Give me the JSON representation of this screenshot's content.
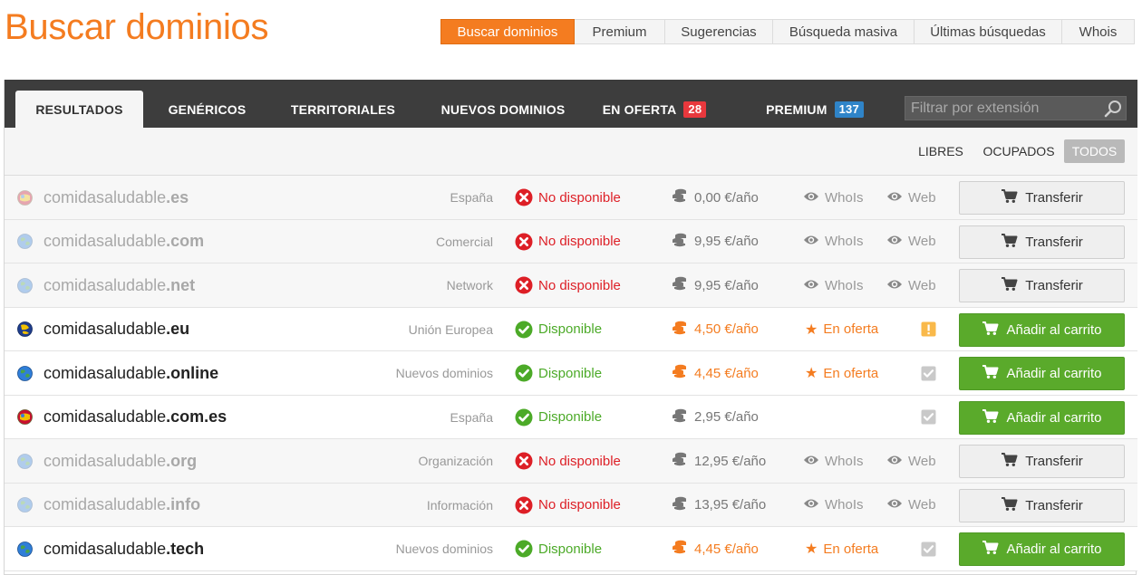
{
  "page": {
    "title": "Buscar dominios"
  },
  "topnav": [
    {
      "label": "Buscar dominios",
      "active": true,
      "w": 148
    },
    {
      "label": "Premium",
      "active": false,
      "w": 100
    },
    {
      "label": "Sugerencias",
      "active": false,
      "w": 119
    },
    {
      "label": "Búsqueda masiva",
      "active": false,
      "w": 156
    },
    {
      "label": "Últimas búsquedas",
      "active": false,
      "w": 163
    },
    {
      "label": "Whois",
      "active": false,
      "w": 80
    }
  ],
  "tabs": [
    {
      "label": "RESULTADOS",
      "active": true
    },
    {
      "label": "GENÉRICOS",
      "active": false
    },
    {
      "label": "TERRITORIALES",
      "active": false
    },
    {
      "label": "NUEVOS DOMINIOS",
      "active": false
    },
    {
      "label": "EN OFERTA",
      "badge": "28",
      "badge_color": "red",
      "active": false
    },
    {
      "label": "PREMIUM",
      "badge": "137",
      "badge_color": "blue",
      "active": false
    }
  ],
  "filter": {
    "placeholder": "Filtrar por extensión"
  },
  "subfilters": [
    {
      "label": "LIBRES",
      "active": false
    },
    {
      "label": "OCUPADOS",
      "active": false
    },
    {
      "label": "TODOS",
      "active": true
    }
  ],
  "labels": {
    "whois": "WhoIs",
    "web": "Web",
    "offer": "En oferta",
    "transfer": "Transferir",
    "add_cart": "Añadir al carrito",
    "available": "Disponible",
    "unavailable": "No disponible"
  },
  "colors": {
    "accent": "#f47c20",
    "available": "#4caa28",
    "unavailable": "#dd1f26",
    "cart": "#5aaa2b"
  },
  "domains": [
    {
      "name": "comidasaludable",
      "ext": ".es",
      "category": "España",
      "available": false,
      "price": "0,00 €/año",
      "offer": false,
      "icon": "globe-spain-icon"
    },
    {
      "name": "comidasaludable",
      "ext": ".com",
      "category": "Comercial",
      "available": false,
      "price": "9,95 €/año",
      "offer": false,
      "icon": "globe-icon"
    },
    {
      "name": "comidasaludable",
      "ext": ".net",
      "category": "Network",
      "available": false,
      "price": "9,95 €/año",
      "offer": false,
      "icon": "globe-icon"
    },
    {
      "name": "comidasaludable",
      "ext": ".eu",
      "category": "Unión Europea",
      "available": true,
      "price": "4,50 €/año",
      "offer": true,
      "check": "warning",
      "icon": "globe-eu-icon"
    },
    {
      "name": "comidasaludable",
      "ext": ".online",
      "category": "Nuevos dominios",
      "available": true,
      "price": "4,45 €/año",
      "offer": true,
      "check": "checked",
      "icon": "globe-icon"
    },
    {
      "name": "comidasaludable",
      "ext": ".com.es",
      "category": "España",
      "available": true,
      "price": "2,95 €/año",
      "offer": false,
      "check": "checked",
      "icon": "globe-spain-icon"
    },
    {
      "name": "comidasaludable",
      "ext": ".org",
      "category": "Organización",
      "available": false,
      "price": "12,95 €/año",
      "offer": false,
      "icon": "globe-icon"
    },
    {
      "name": "comidasaludable",
      "ext": ".info",
      "category": "Información",
      "available": false,
      "price": "13,95 €/año",
      "offer": false,
      "icon": "globe-icon"
    },
    {
      "name": "comidasaludable",
      "ext": ".tech",
      "category": "Nuevos dominios",
      "available": true,
      "price": "4,45 €/año",
      "offer": true,
      "check": "checked",
      "icon": "globe-icon"
    }
  ]
}
